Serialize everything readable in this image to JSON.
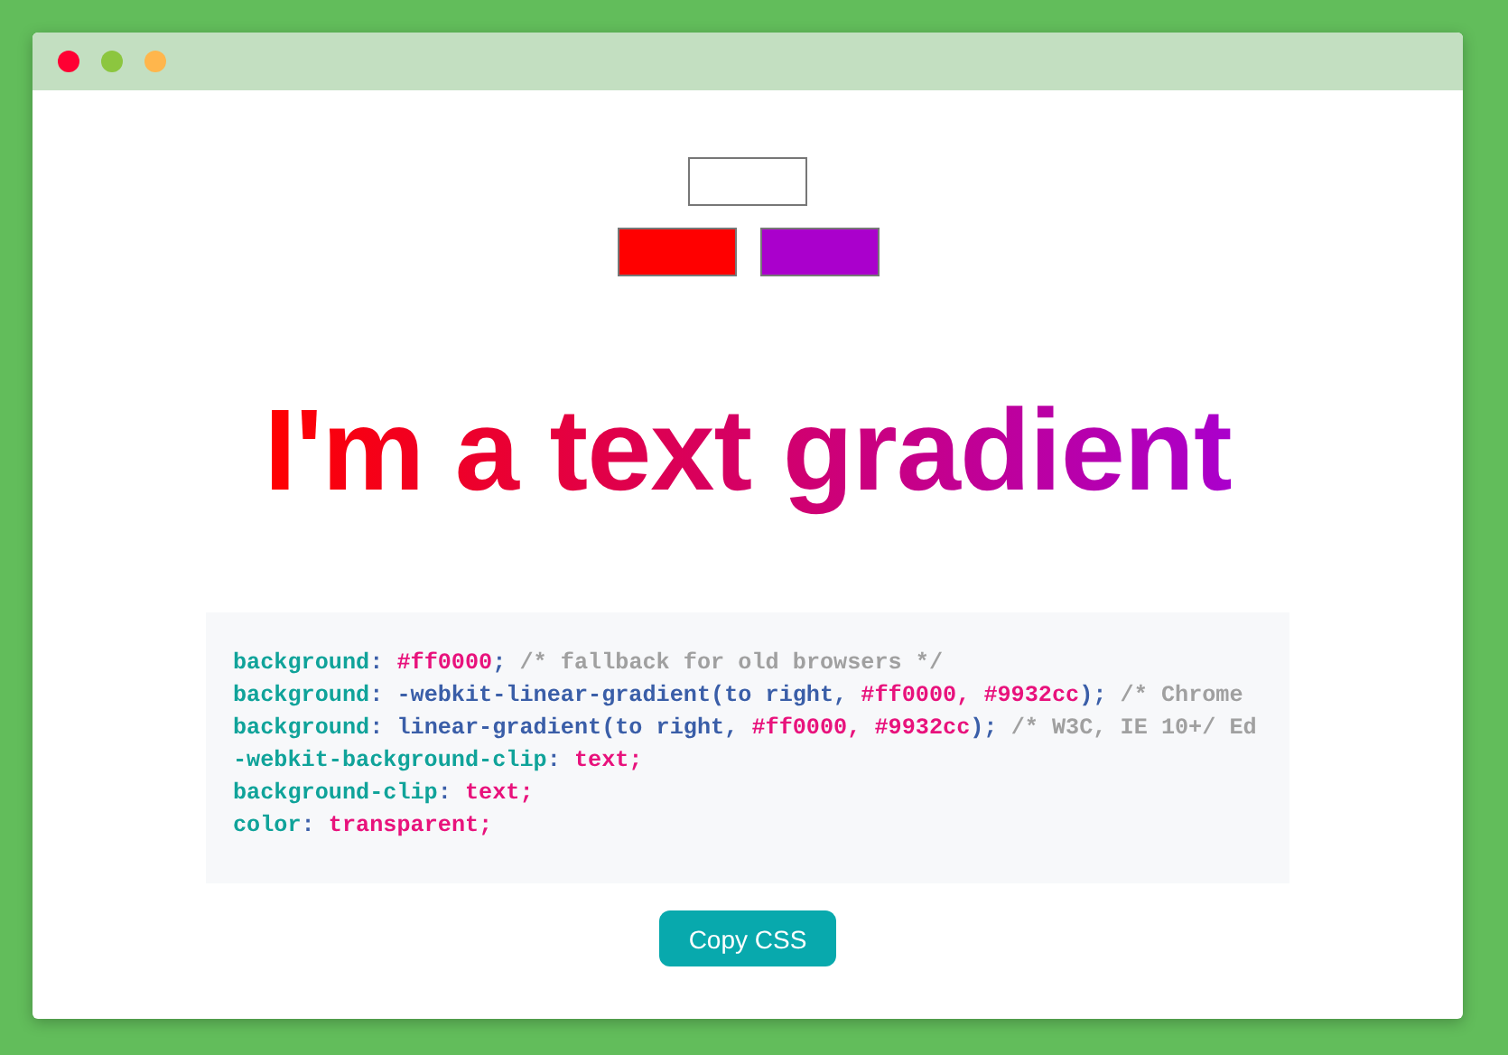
{
  "window": {
    "dots": [
      {
        "color": "#ff0033"
      },
      {
        "color": "#8cc63f"
      },
      {
        "color": "#ffb64c"
      }
    ]
  },
  "swatches": [
    {
      "color": "#ff0000"
    },
    {
      "color": "#aa00cc"
    }
  ],
  "heading": "I'm a text gradient",
  "code": [
    [
      {
        "kind": "prop",
        "text": "background"
      },
      {
        "kind": "punct",
        "text": ": "
      },
      {
        "kind": "value",
        "text": "#ff0000"
      },
      {
        "kind": "punct",
        "text": "; "
      },
      {
        "kind": "comment",
        "text": "/* fallback for old browsers */"
      }
    ],
    [
      {
        "kind": "prop",
        "text": "background"
      },
      {
        "kind": "punct",
        "text": ": "
      },
      {
        "kind": "func",
        "text": "-webkit-linear-gradient(to right, "
      },
      {
        "kind": "value",
        "text": "#ff0000, #9932cc"
      },
      {
        "kind": "func",
        "text": "); "
      },
      {
        "kind": "comment",
        "text": "/* Chrome"
      }
    ],
    [
      {
        "kind": "prop",
        "text": "background"
      },
      {
        "kind": "punct",
        "text": ": "
      },
      {
        "kind": "func",
        "text": "linear-gradient(to right, "
      },
      {
        "kind": "value",
        "text": "#ff0000, #9932cc"
      },
      {
        "kind": "func",
        "text": "); "
      },
      {
        "kind": "comment",
        "text": "/* W3C, IE 10+/ Ed"
      }
    ],
    [
      {
        "kind": "prop",
        "text": "-webkit-background-clip"
      },
      {
        "kind": "punct",
        "text": ": "
      },
      {
        "kind": "value",
        "text": "text;"
      }
    ],
    [
      {
        "kind": "prop",
        "text": "background-clip"
      },
      {
        "kind": "punct",
        "text": ": "
      },
      {
        "kind": "value",
        "text": "text;"
      }
    ],
    [
      {
        "kind": "prop",
        "text": "color"
      },
      {
        "kind": "punct",
        "text": ": "
      },
      {
        "kind": "value",
        "text": "transparent;"
      }
    ]
  ],
  "button": "Copy CSS"
}
